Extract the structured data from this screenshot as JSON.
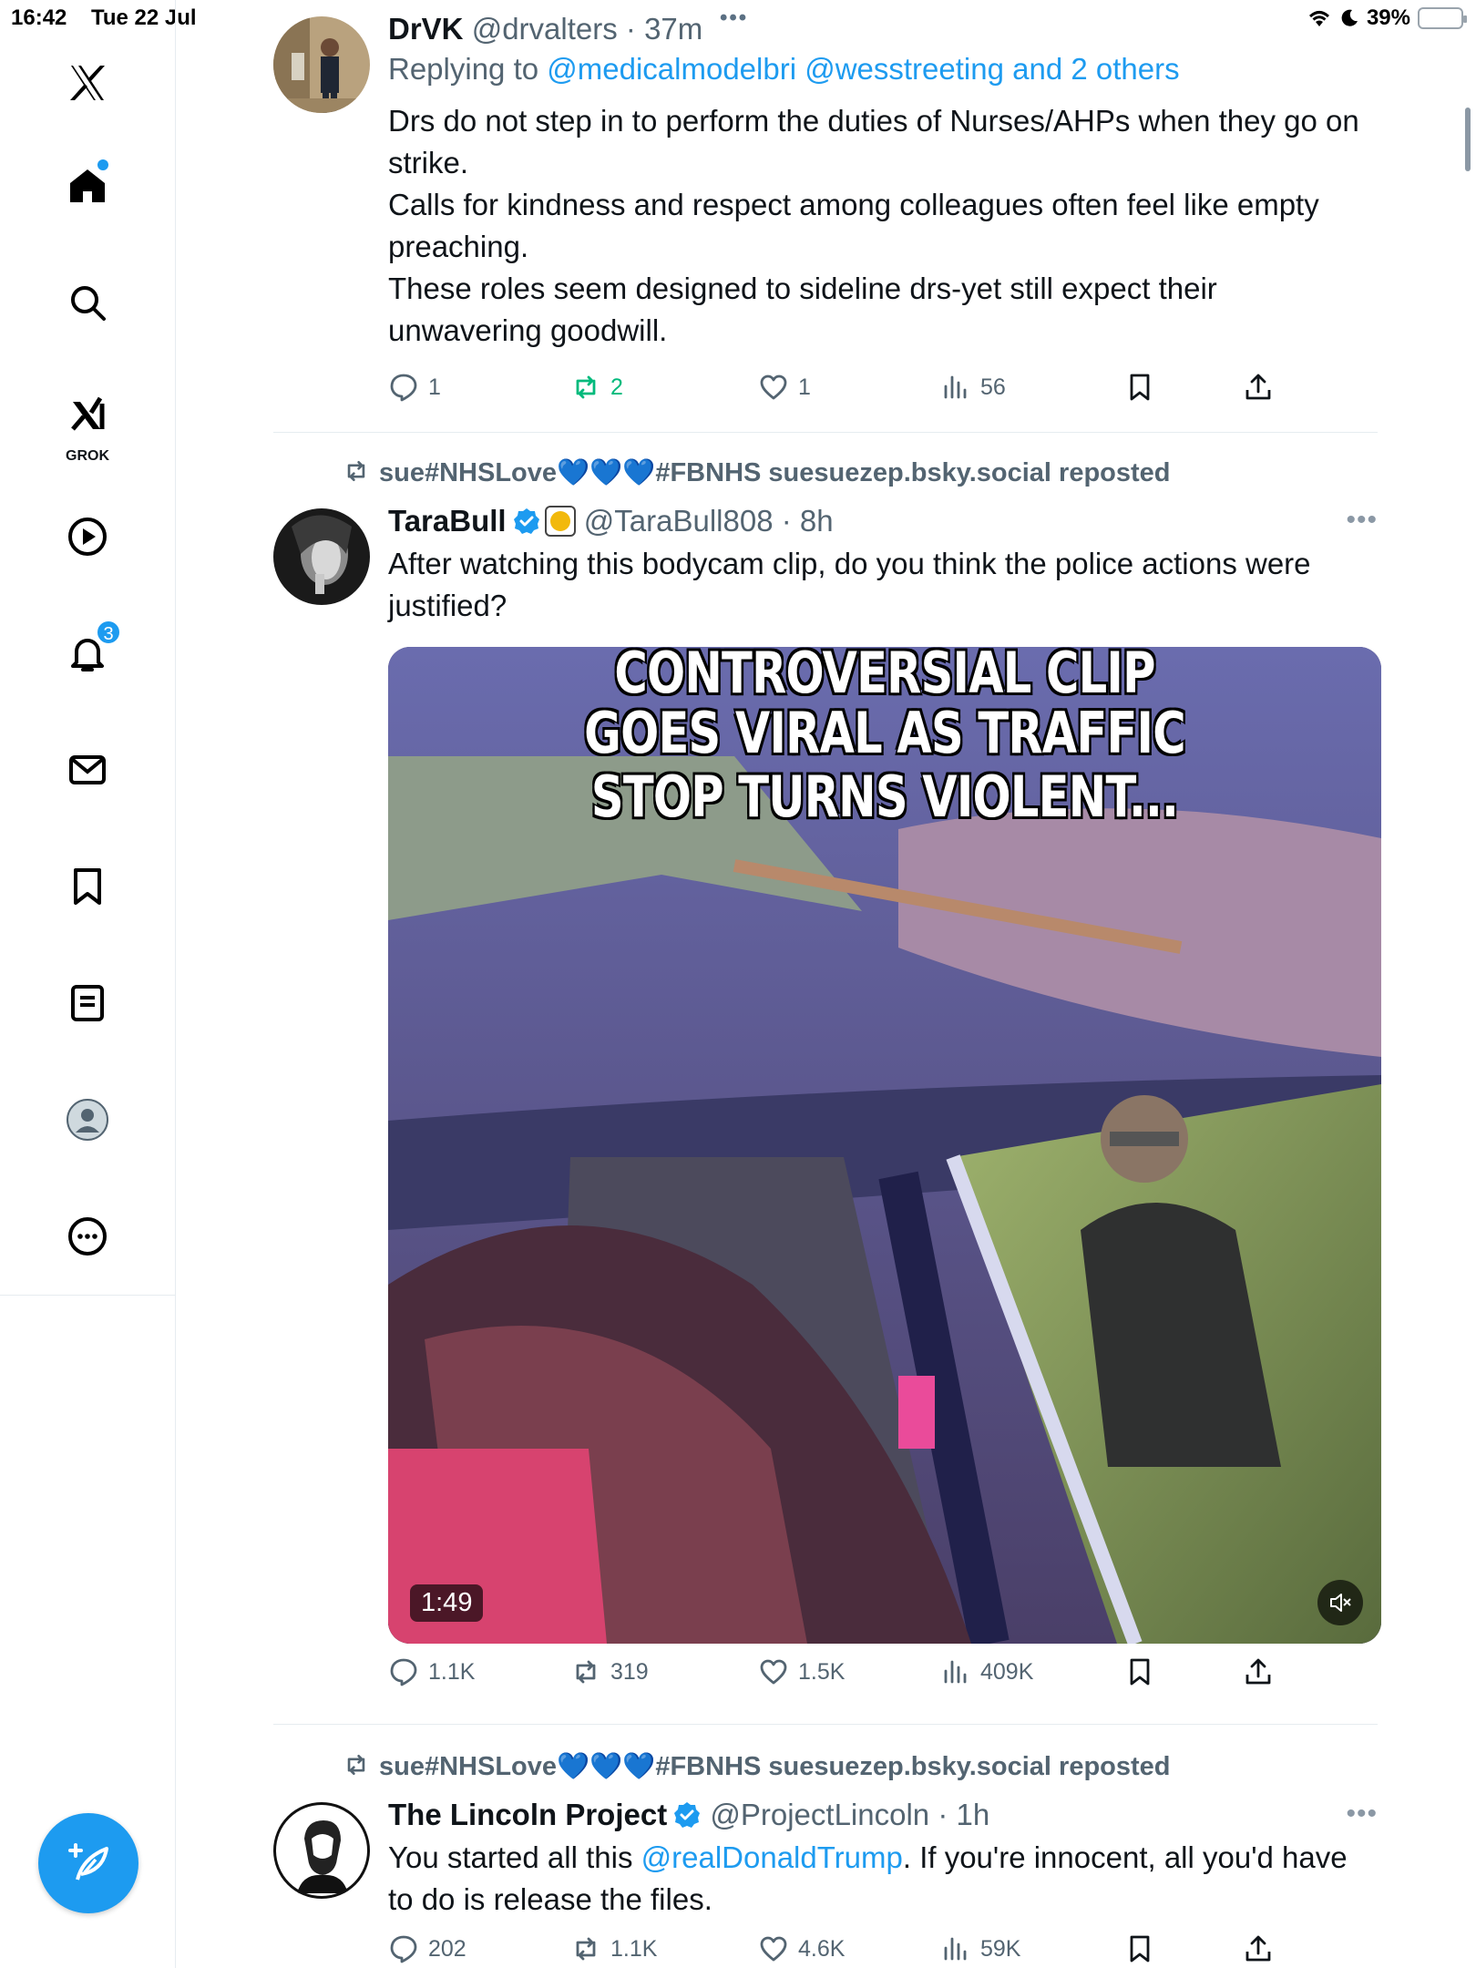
{
  "status_bar": {
    "time": "16:42",
    "date": "Tue 22 Jul",
    "battery": "39%",
    "battery_level": 0.39
  },
  "sidebar": {
    "items": [
      {
        "icon": "x-logo-icon"
      },
      {
        "icon": "home-icon",
        "has_dot": true
      },
      {
        "icon": "search-icon"
      },
      {
        "icon": "grok-icon",
        "label": "GROK"
      },
      {
        "icon": "video-icon"
      },
      {
        "icon": "notifications-icon",
        "badge": "3"
      },
      {
        "icon": "messages-icon"
      },
      {
        "icon": "bookmarks-icon"
      },
      {
        "icon": "lists-icon"
      },
      {
        "icon": "profile-icon"
      },
      {
        "icon": "more-icon"
      }
    ],
    "compose_icon": "compose-post-icon"
  },
  "tweets": [
    {
      "name": "DrVK",
      "handle": "@drvalters",
      "time": "· 37m",
      "reply_prefix": "Replying to ",
      "reply_to": "@medicalmodelbri @wesstreeting and 2 others",
      "text": "Drs do not step in to perform the duties of Nurses/AHPs when they go on strike.\nCalls for kindness and respect among colleagues often feel like empty preaching.\nThese roles seem designed to sideline drs-yet still expect their unwavering goodwill.",
      "replies": "1",
      "reposts": "2",
      "likes": "1",
      "views": "56",
      "reposted_by_me": true
    },
    {
      "repost_label": "sue#NHSLove💙💙💙#FBNHS suesuezep.bsky.social reposted",
      "name": "TaraBull",
      "handle": "@TaraBull808",
      "time": "· 8h",
      "text": "After watching this bodycam clip, do you think the police actions were justified?",
      "media": {
        "caption_lines": [
          "CONTROVERSIAL CLIP",
          "GOES VIRAL AS TRAFFIC",
          "STOP TURNS VIOLENT..."
        ],
        "duration": "1:49"
      },
      "replies": "1.1K",
      "reposts": "319",
      "likes": "1.5K",
      "views": "409K"
    },
    {
      "repost_label": "sue#NHSLove💙💙💙#FBNHS suesuezep.bsky.social reposted",
      "name": "The Lincoln Project",
      "handle": "@ProjectLincoln",
      "time": "· 1h",
      "text_before": "You started all this ",
      "mention": "@realDonaldTrump",
      "text_after": ". If you're innocent, all you'd have to do is release the files.",
      "replies": "202",
      "reposts": "1.1K",
      "likes": "4.6K",
      "views": "59K"
    }
  ]
}
